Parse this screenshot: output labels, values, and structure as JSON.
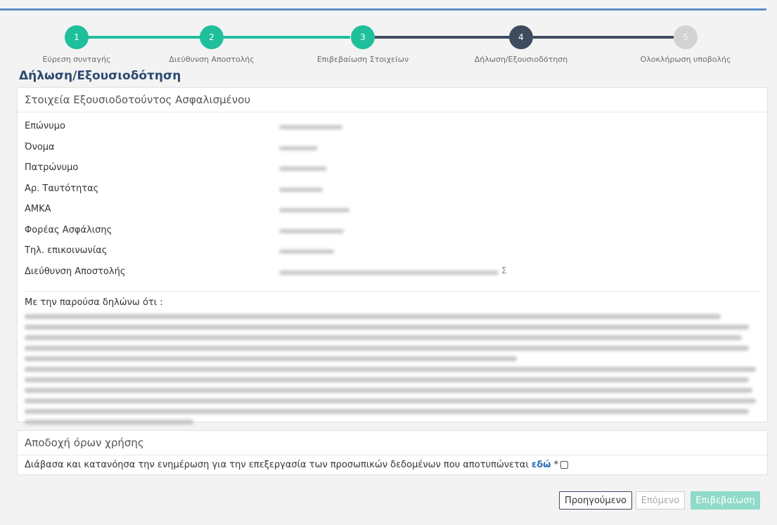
{
  "steps": [
    {
      "number": "1",
      "label": "Εύρεση συνταγής"
    },
    {
      "number": "2",
      "label": "Διεύθυνση Αποστολής"
    },
    {
      "number": "3",
      "label": "Επιβεβαίωση Στοιχείων"
    },
    {
      "number": "4",
      "label": "Δήλωση/Εξουσιοδότηση"
    },
    {
      "number": "5",
      "label": "Ολοκλήρωση υποβολής"
    }
  ],
  "current_step": 4,
  "page_title": "Δήλωση/Εξουσιοδότηση",
  "insured_panel": {
    "title": "Στοιχεία Εξουσιοδοτούντος Ασφαλισμένου",
    "fields": [
      {
        "label": "Επώνυμο"
      },
      {
        "label": "Όνομα"
      },
      {
        "label": "Πατρώνυμο"
      },
      {
        "label": "Αρ. Ταυτότητας"
      },
      {
        "label": "ΑΜΚΑ"
      },
      {
        "label": "Φορέας Ασφάλισης"
      },
      {
        "label": "Τηλ. επικοινωνίας"
      },
      {
        "label": "Διεύθυνση Αποστολής"
      }
    ],
    "address_visible_suffix": "Σ",
    "declaration_label": "Με την παρούσα δηλώνω ότι :"
  },
  "terms_panel": {
    "title": "Αποδοχή όρων χρήσης",
    "text": "Διάβασα και κατανόησα την ενημέρωση για την επεξεργασία των προσωπικών δεδομένων που αποτυπώνεται",
    "link_text": "εδώ",
    "required_mark": "*"
  },
  "buttons": {
    "previous": "Προηγούμενο",
    "next": "Επόμενο",
    "confirm": "Επιβεβαίωση"
  },
  "colors": {
    "done": "#1fbf9c",
    "current": "#3e4b5e",
    "pending": "#d3d3d3",
    "title": "#2b4a70"
  }
}
